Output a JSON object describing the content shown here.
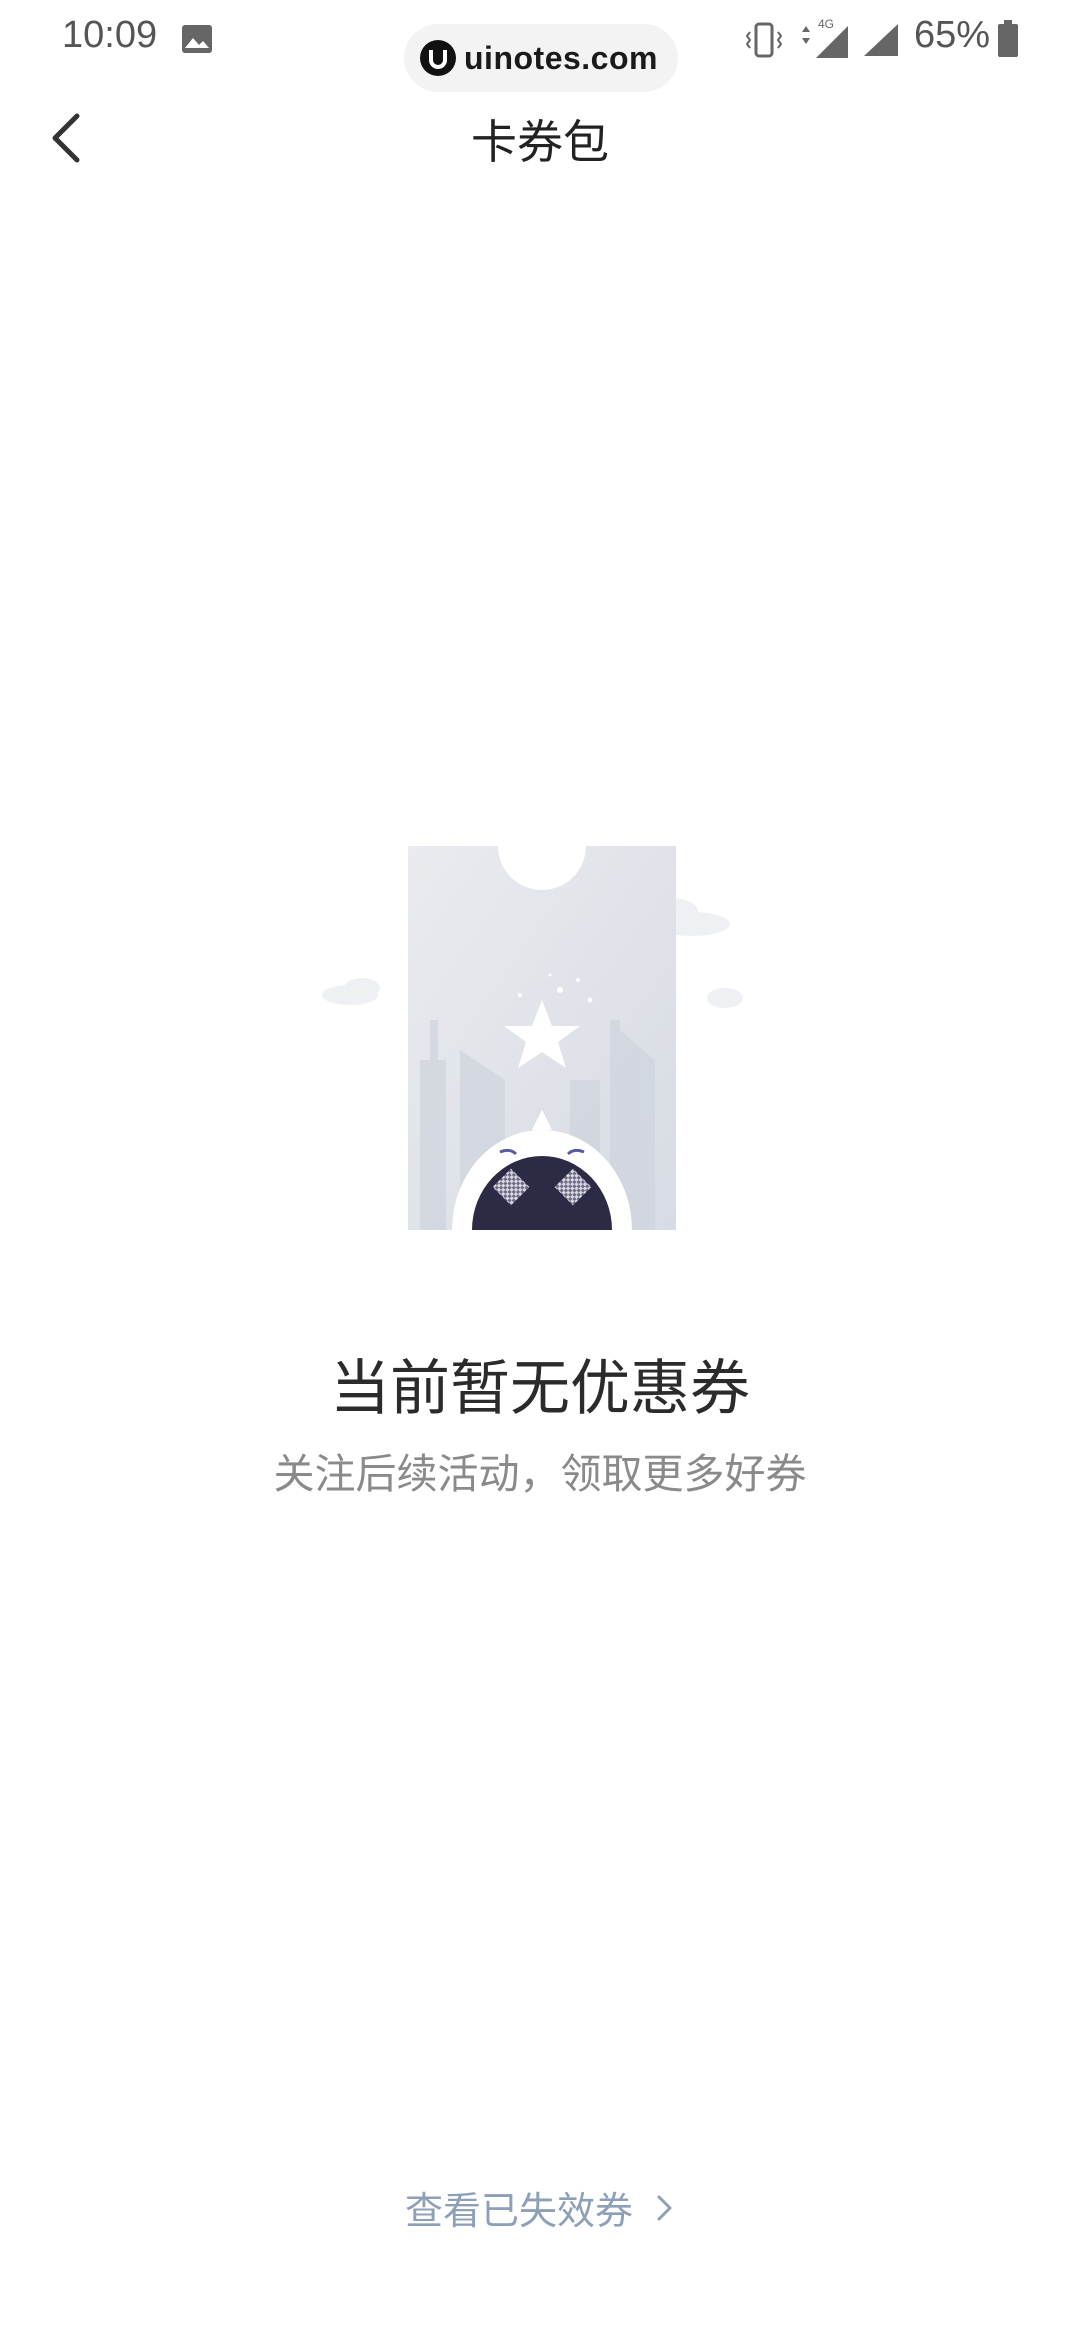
{
  "status_bar": {
    "time": "10:09",
    "battery_percent": "65%",
    "network_type": "4G",
    "icons": [
      "image-icon",
      "vibrate-icon",
      "signal-4g-icon",
      "signal-icon",
      "battery-icon"
    ]
  },
  "watermark": {
    "text": "uinotes.com"
  },
  "header": {
    "title": "卡券包",
    "back_icon": "chevron-left-icon"
  },
  "empty_state": {
    "title": "当前暂无优惠券",
    "subtitle": "关注后续活动，领取更多好券",
    "illustration": "coupon-ticket-robot-illustration"
  },
  "footer": {
    "expired_link_label": "查看已失效券",
    "chevron_icon": "chevron-right-icon"
  },
  "colors": {
    "background": "#ffffff",
    "title_text": "#222222",
    "subtitle_text": "#8a8a8a",
    "link_text": "#8ea0b8",
    "robot_face": "#2d2a45"
  }
}
